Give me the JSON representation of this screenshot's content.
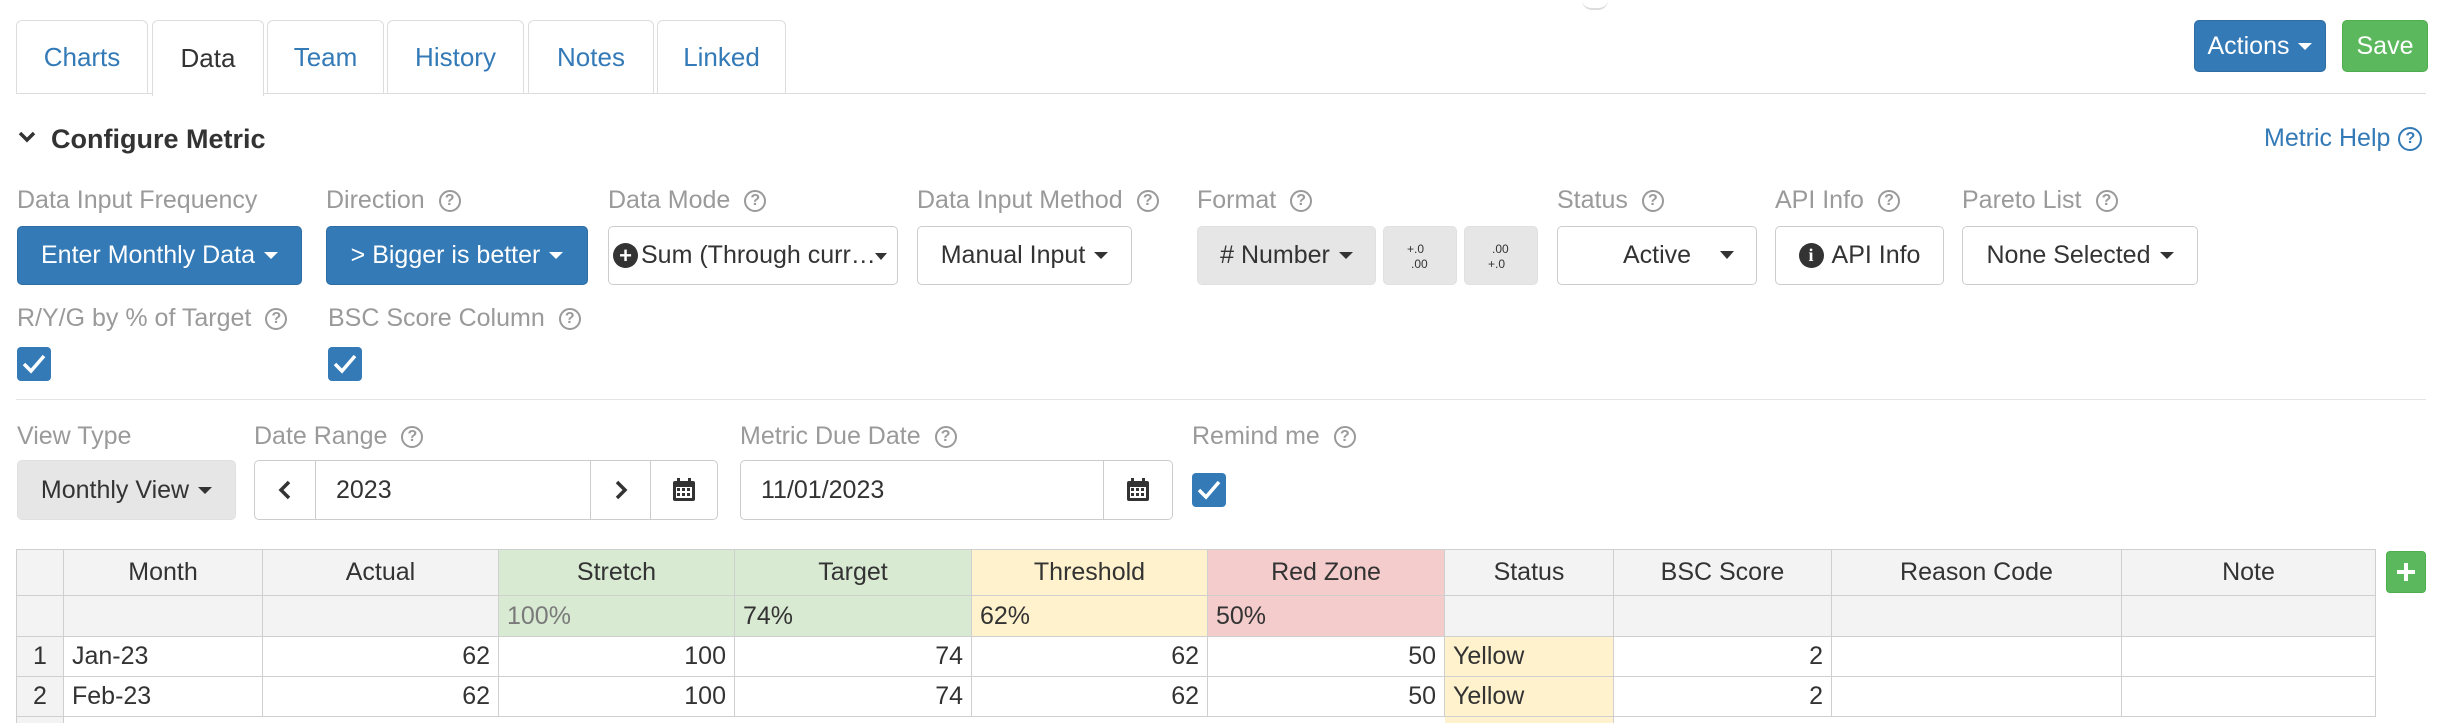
{
  "tabs": [
    {
      "label": "Charts"
    },
    {
      "label": "Data"
    },
    {
      "label": "Team"
    },
    {
      "label": "History"
    },
    {
      "label": "Notes"
    },
    {
      "label": "Linked"
    }
  ],
  "header": {
    "actions_label": "Actions",
    "save_label": "Save",
    "section_title": "Configure Metric",
    "help_link": "Metric Help"
  },
  "config": {
    "frequency": {
      "label": "Data Input Frequency",
      "value": "Enter Monthly Data"
    },
    "direction": {
      "label": "Direction",
      "value": "> Bigger is better"
    },
    "data_mode": {
      "label": "Data Mode",
      "value": "Sum (Through curr…"
    },
    "input_method": {
      "label": "Data Input Method",
      "value": "Manual Input"
    },
    "format": {
      "label": "Format",
      "value": "# Number",
      "increase_decimals": "+.0 .00",
      "decrease_decimals": ".00 +.0"
    },
    "status": {
      "label": "Status",
      "value": "Active"
    },
    "api_info": {
      "label": "API Info",
      "value": "API Info"
    },
    "pareto": {
      "label": "Pareto List",
      "value": "None Selected"
    },
    "ryg": {
      "label": "R/Y/G by % of Target",
      "checked": true
    },
    "bsc": {
      "label": "BSC Score Column",
      "checked": true
    }
  },
  "view": {
    "view_type": {
      "label": "View Type",
      "value": "Monthly View"
    },
    "date_range": {
      "label": "Date Range",
      "value": "2023"
    },
    "due_date": {
      "label": "Metric Due Date",
      "value": "11/01/2023"
    },
    "remind": {
      "label": "Remind me",
      "checked": true
    }
  },
  "colors": {
    "stretch": "#d9ead3",
    "target": "#d9ead3",
    "threshold": "#fff2cc",
    "red_zone": "#f4cccc",
    "yellow_status": "#fff2cc"
  },
  "table": {
    "columns": [
      "Month",
      "Actual",
      "Stretch",
      "Target",
      "Threshold",
      "Red Zone",
      "Status",
      "BSC Score",
      "Reason Code",
      "Note"
    ],
    "percent_row": {
      "stretch": "100%",
      "target": "74%",
      "threshold": "62%",
      "red_zone": "50%"
    },
    "rows": [
      {
        "n": "1",
        "month": "Jan-23",
        "actual": "62",
        "stretch": "100",
        "target": "74",
        "threshold": "62",
        "red_zone": "50",
        "status": "Yellow",
        "bsc": "2",
        "reason": "",
        "note": ""
      },
      {
        "n": "2",
        "month": "Feb-23",
        "actual": "62",
        "stretch": "100",
        "target": "74",
        "threshold": "62",
        "red_zone": "50",
        "status": "Yellow",
        "bsc": "2",
        "reason": "",
        "note": ""
      }
    ]
  }
}
